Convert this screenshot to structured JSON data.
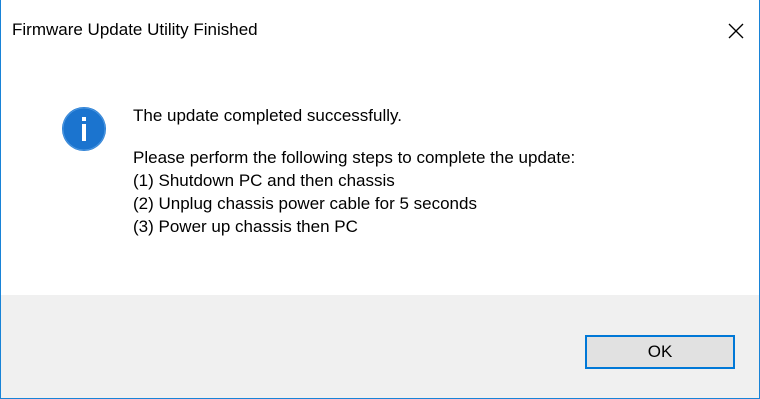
{
  "window": {
    "title": "Firmware Update Utility Finished",
    "close_icon": "close-icon",
    "border_color": "#1883d7"
  },
  "content": {
    "icon": "info-icon",
    "icon_color": "#1b74cf",
    "headline": "The update completed successfully.",
    "instruction": "Please perform the following steps to complete the update:",
    "steps": [
      "(1) Shutdown PC and then chassis",
      "(2) Unplug chassis power cable for 5 seconds",
      "(3) Power up chassis then PC"
    ]
  },
  "footer": {
    "ok_label": "OK",
    "ok_border_color": "#0078d7"
  }
}
